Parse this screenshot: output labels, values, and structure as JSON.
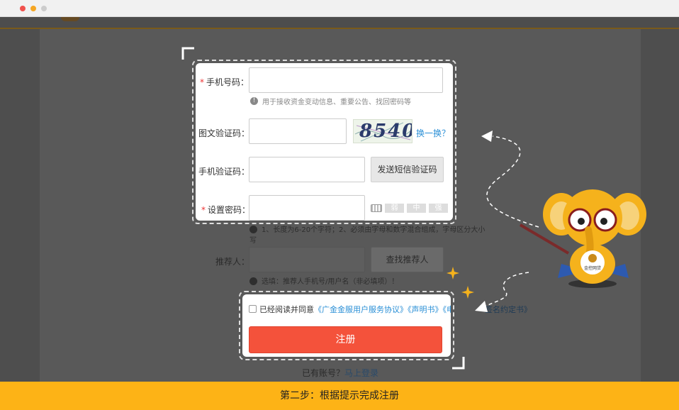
{
  "form": {
    "phone": {
      "label": "手机号码：",
      "required": true,
      "hint": "用于接收资金变动信息、重要公告、找回密码等"
    },
    "captcha": {
      "label": "图文验证码：",
      "image_text": "8540",
      "refresh_link": "换一换？"
    },
    "sms": {
      "label": "手机验证码：",
      "button": "发送短信验证码"
    },
    "password": {
      "label": "设置密码：",
      "required": true,
      "strength": [
        "弱",
        "中",
        "强"
      ],
      "hint": "1、长度为6-20个字符；2、必须由字母和数字混合组成，字母区分大小写"
    },
    "referrer": {
      "label": "推荐人：",
      "button": "查找推荐人",
      "hint": "选填：推荐人手机号/用户名（非必填项）！"
    },
    "agreement": {
      "prefix": "已经阅读并同意",
      "doc1": "《广金金服用户服务协议》",
      "doc2": "《声明书》",
      "doc3_visible": "《电子",
      "doc3_overflow": "签名约定书》"
    },
    "register_button": "注册",
    "login_prompt": {
      "text": "已有账号？",
      "link": "马上登录"
    }
  },
  "mascot": {
    "badge_text": "金控网贷"
  },
  "caption": "第二步：根据提示完成注册",
  "colors": {
    "accent": "#f4523b",
    "caption_bg": "#fdb316",
    "link": "#2a8fd6"
  }
}
